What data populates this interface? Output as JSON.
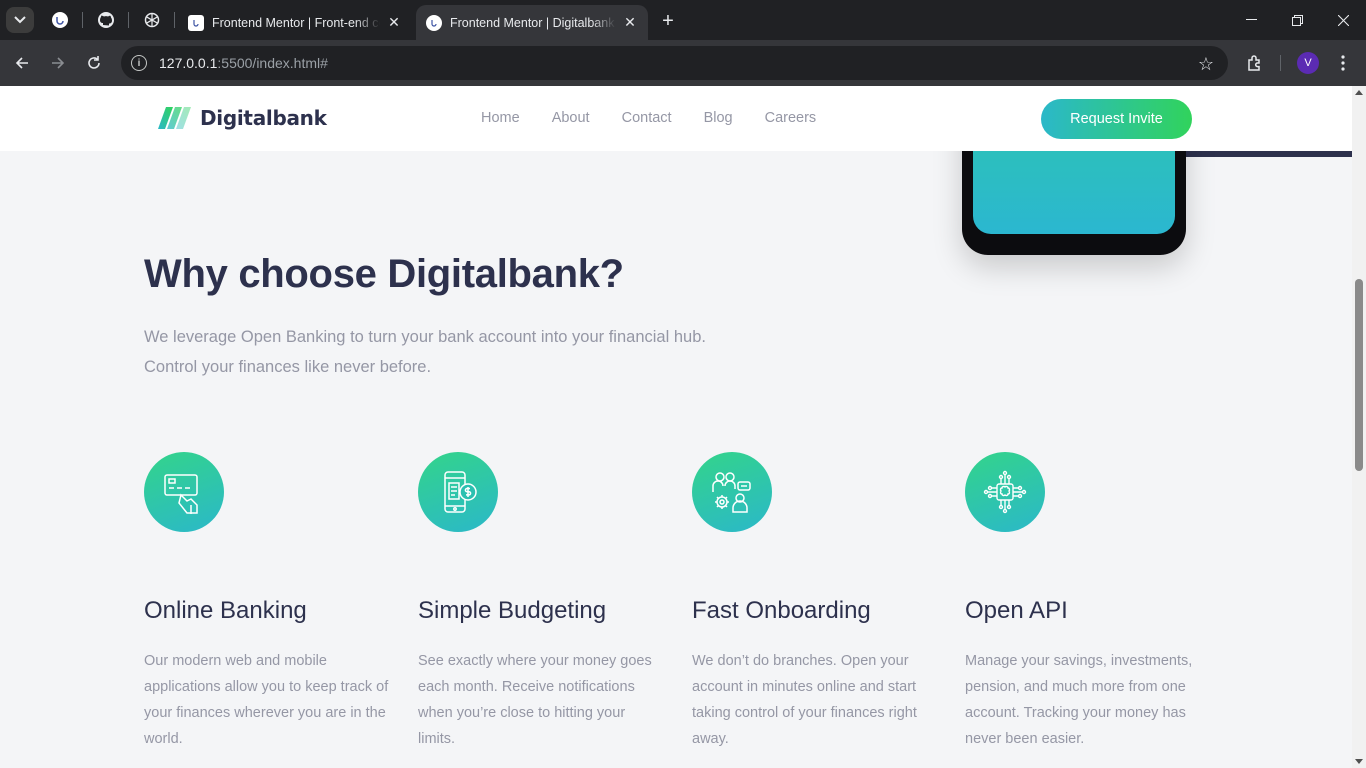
{
  "browser": {
    "tabs": [
      {
        "title": "Frontend Mentor | Front-end coding challenges",
        "active": false
      },
      {
        "title": "Frontend Mentor | Digitalbank landing page",
        "active": true
      }
    ],
    "new_tab_label": "+",
    "url_host": "127.0.0.1",
    "url_rest": ":5500/index.html#",
    "profile_initial": "V",
    "profile_color": "#5b2bb3"
  },
  "site": {
    "logo_text": "Digitalbank",
    "nav": [
      "Home",
      "About",
      "Contact",
      "Blog",
      "Careers"
    ],
    "cta_label": "Request Invite",
    "colors": {
      "dark_blue": "#2d314d",
      "lime": "#31d35c",
      "cyan": "#2bb8c9",
      "grayish": "#9597a5",
      "light_bg": "#f4f5f7"
    }
  },
  "section": {
    "title": "Why choose Digitalbank?",
    "lead_line1": "We leverage Open Banking to turn your bank account into your financial hub.",
    "lead_line2": "Control your finances like never before.",
    "features": [
      {
        "icon": "online-banking-icon",
        "title": "Online Banking",
        "text": "Our modern web and mobile applications allow you to keep track of your finances wherever you are in the world."
      },
      {
        "icon": "budgeting-icon",
        "title": "Simple Budgeting",
        "text": "See exactly where your money goes each month. Receive notifications when you’re close to hitting your limits."
      },
      {
        "icon": "onboarding-icon",
        "title": "Fast Onboarding",
        "text": "We don’t do branches. Open your account in minutes online and start taking control of your finances right away."
      },
      {
        "icon": "api-icon",
        "title": "Open API",
        "text": "Manage your savings, investments, pension, and much more from one account. Tracking your money has never been easier."
      }
    ]
  }
}
